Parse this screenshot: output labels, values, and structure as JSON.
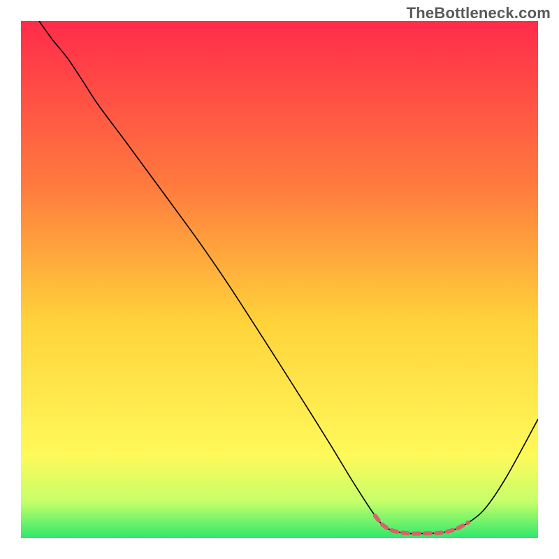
{
  "watermark": "TheBottleneck.com",
  "chart_data": {
    "type": "line",
    "title": "",
    "xlabel": "",
    "ylabel": "",
    "xlim": [
      0,
      100
    ],
    "ylim": [
      0,
      100
    ],
    "gradient_colors": {
      "top": "#ff2b4a",
      "mid1": "#ff7b3e",
      "mid2": "#ffd23a",
      "mid3": "#fff95a",
      "bottom": "#2ee86b"
    },
    "series": [
      {
        "name": "bottleneck-curve",
        "color": "#000000",
        "stroke_width": 1.6,
        "points": [
          {
            "x": 3.5,
            "y": 100
          },
          {
            "x": 6,
            "y": 96.5
          },
          {
            "x": 9,
            "y": 92.8
          },
          {
            "x": 12,
            "y": 88.3
          },
          {
            "x": 15,
            "y": 83.7
          },
          {
            "x": 20,
            "y": 77.0
          },
          {
            "x": 25,
            "y": 70.2
          },
          {
            "x": 30,
            "y": 63.4
          },
          {
            "x": 35,
            "y": 56.5
          },
          {
            "x": 40,
            "y": 49.2
          },
          {
            "x": 45,
            "y": 41.5
          },
          {
            "x": 50,
            "y": 33.7
          },
          {
            "x": 55,
            "y": 25.8
          },
          {
            "x": 60,
            "y": 17.8
          },
          {
            "x": 64,
            "y": 11.2
          },
          {
            "x": 68,
            "y": 5.0
          },
          {
            "x": 70,
            "y": 2.5
          },
          {
            "x": 72,
            "y": 1.4
          },
          {
            "x": 75,
            "y": 0.9
          },
          {
            "x": 78,
            "y": 0.9
          },
          {
            "x": 81,
            "y": 1.0
          },
          {
            "x": 84,
            "y": 1.7
          },
          {
            "x": 87,
            "y": 3.3
          },
          {
            "x": 90,
            "y": 6.0
          },
          {
            "x": 94,
            "y": 12.0
          },
          {
            "x": 100,
            "y": 23.0
          }
        ]
      },
      {
        "name": "optimal-marker",
        "color": "#d9626b",
        "stroke_width": 6,
        "dasharray": "8 8",
        "points": [
          {
            "x": 68.5,
            "y": 4.3
          },
          {
            "x": 70,
            "y": 2.5
          },
          {
            "x": 72,
            "y": 1.4
          },
          {
            "x": 75,
            "y": 0.9
          },
          {
            "x": 78,
            "y": 0.9
          },
          {
            "x": 81,
            "y": 1.0
          },
          {
            "x": 84,
            "y": 1.7
          },
          {
            "x": 86.5,
            "y": 3.0
          }
        ]
      }
    ]
  }
}
